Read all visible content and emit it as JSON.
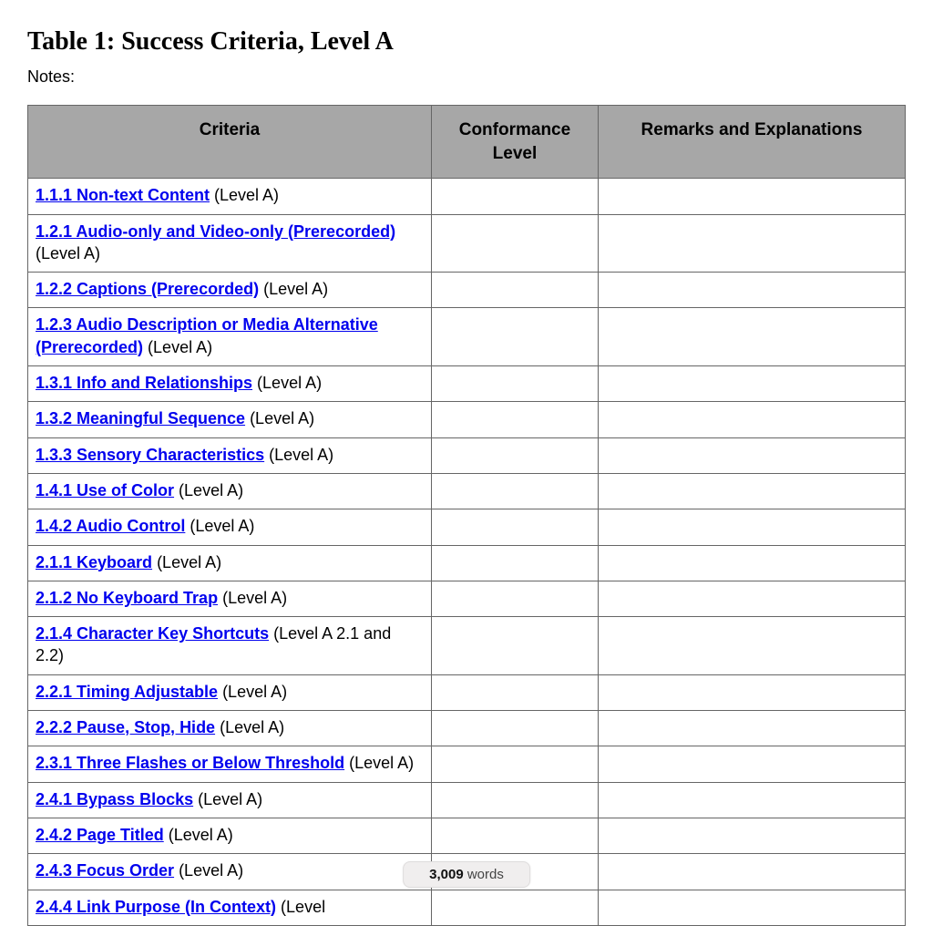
{
  "title": "Table 1: Success Criteria, Level A",
  "notes_label": "Notes:",
  "headers": {
    "criteria": "Criteria",
    "level": "Conformance Level",
    "remarks": "Remarks and Explanations"
  },
  "rows": [
    {
      "link": "1.1.1 Non-text Content",
      "suffix": " (Level A)",
      "level": "",
      "remarks": ""
    },
    {
      "link": "1.2.1 Audio-only and Video-only (Prerecorded)",
      "suffix": " (Level A)",
      "level": "",
      "remarks": ""
    },
    {
      "link": "1.2.2 Captions (Prerecorded)",
      "suffix": " (Level A)",
      "level": "",
      "remarks": ""
    },
    {
      "link": "1.2.3 Audio Description or Media Alternative (Prerecorded)",
      "suffix": " (Level A)",
      "level": "",
      "remarks": ""
    },
    {
      "link": "1.3.1 Info and Relationships",
      "suffix": " (Level A)",
      "level": "",
      "remarks": ""
    },
    {
      "link": "1.3.2 Meaningful Sequence",
      "suffix": " (Level A)",
      "level": "",
      "remarks": ""
    },
    {
      "link": "1.3.3 Sensory Characteristics",
      "suffix": "  (Level A)",
      "level": "",
      "remarks": ""
    },
    {
      "link": "1.4.1 Use of Color",
      "suffix": " (Level A)",
      "level": "",
      "remarks": ""
    },
    {
      "link": "1.4.2 Audio Control",
      "suffix": " (Level A)",
      "level": "",
      "remarks": ""
    },
    {
      "link": "2.1.1 Keyboard",
      "suffix": " (Level A)",
      "level": "",
      "remarks": ""
    },
    {
      "link": "2.1.2 No Keyboard Trap",
      "suffix": " (Level A)",
      "level": "",
      "remarks": ""
    },
    {
      "link": "2.1.4 Character Key Shortcuts",
      "suffix": " (Level A 2.1 and 2.2)",
      "level": "",
      "remarks": ""
    },
    {
      "link": "2.2.1 Timing Adjustable",
      "suffix": " (Level A)",
      "level": "",
      "remarks": ""
    },
    {
      "link": "2.2.2 Pause, Stop, Hide",
      "suffix": " (Level A)",
      "level": "",
      "remarks": ""
    },
    {
      "link": "2.3.1 Three Flashes or Below Threshold",
      "suffix": " (Level A)",
      "level": "",
      "remarks": ""
    },
    {
      "link": "2.4.1 Bypass Blocks",
      "suffix": " (Level A)",
      "level": "",
      "remarks": ""
    },
    {
      "link": "2.4.2 Page Titled",
      "suffix": " (Level A)",
      "level": "",
      "remarks": ""
    },
    {
      "link": "2.4.3 Focus Order",
      "suffix": " (Level A)",
      "level": "",
      "remarks": ""
    },
    {
      "link": "2.4.4 Link Purpose (In Context)",
      "suffix": " (Level",
      "level": "",
      "remarks": ""
    }
  ],
  "word_counter": {
    "count": "3,009",
    "label": "words"
  }
}
